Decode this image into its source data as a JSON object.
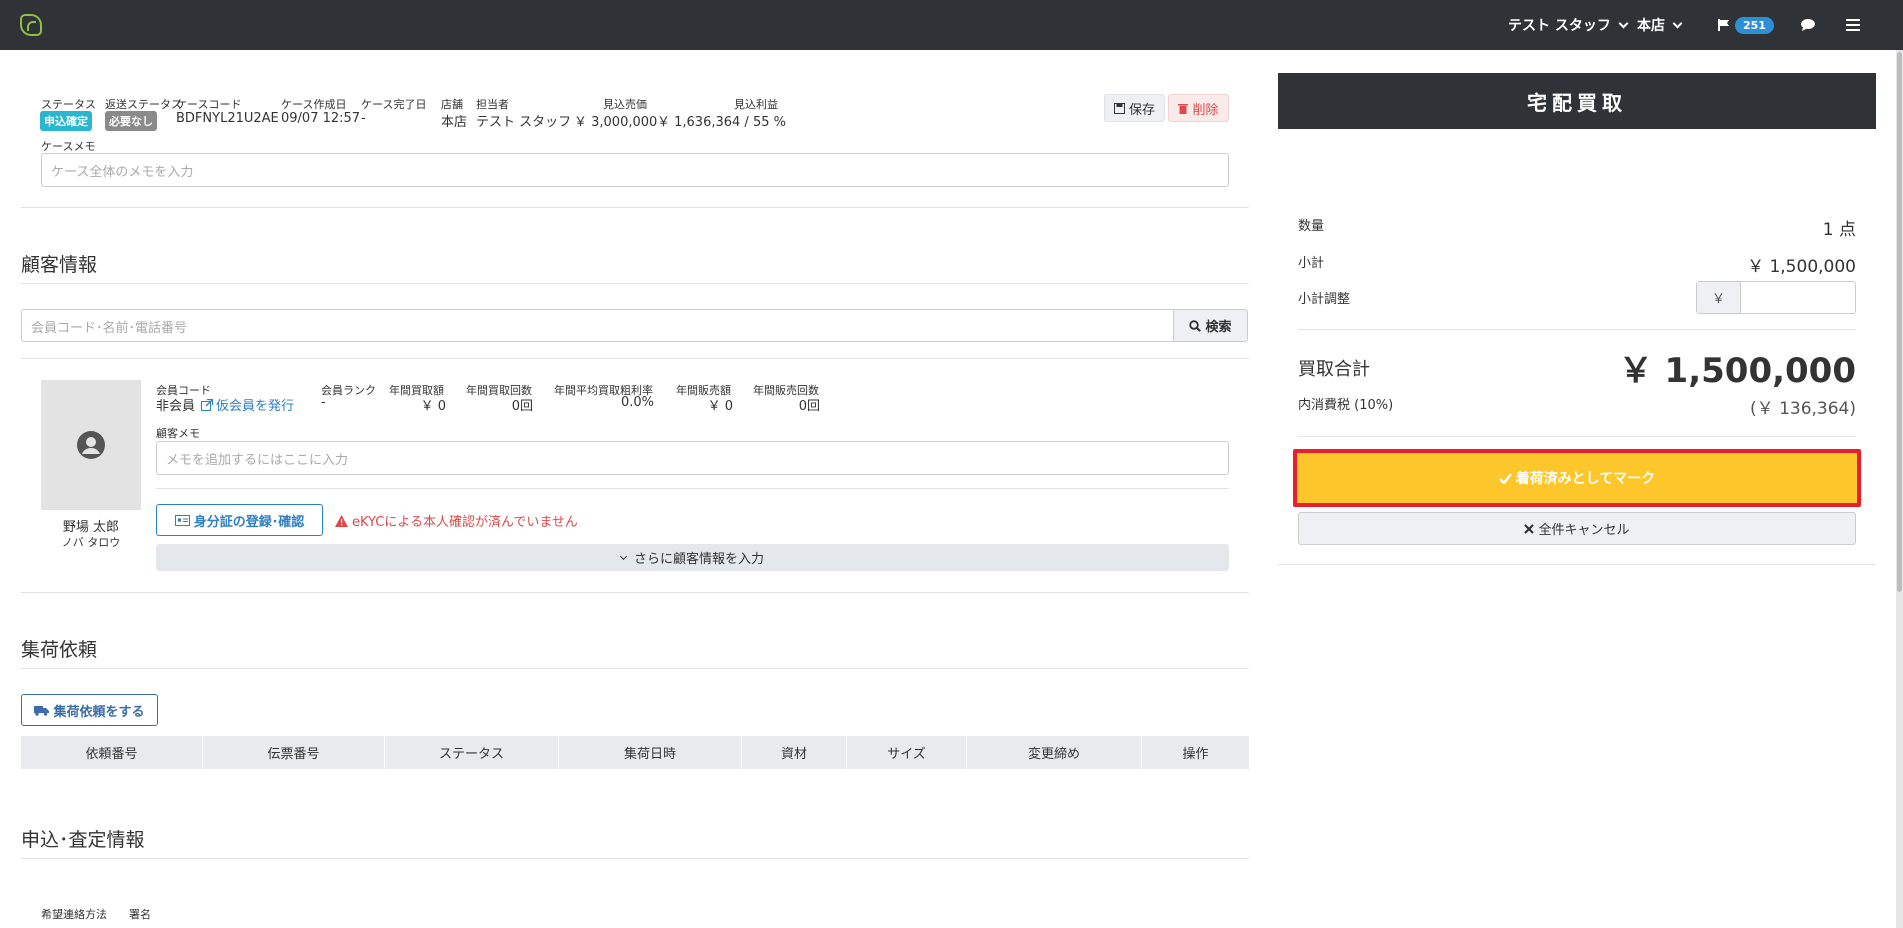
{
  "topbar": {
    "staff_label": "テスト スタッフ",
    "store_label": "本店",
    "notification_count": "251"
  },
  "case": {
    "labels": {
      "status": "ステータス",
      "return_status": "返送ステータス",
      "case_code": "ケースコード",
      "created": "ケース作成日",
      "completed": "ケース完了日",
      "store": "店舗",
      "assignee": "担当者",
      "expected_sales": "見込売価",
      "expected_profit": "見込利益",
      "memo": "ケースメモ"
    },
    "status_badge": "申込確定",
    "return_status_badge": "必要なし",
    "case_code": "BDFNYL21U2AE",
    "created": "09/07 12:57",
    "completed": "-",
    "store": "本店",
    "assignee": "テスト スタッフ",
    "expected_sales": "￥ 3,000,000",
    "expected_profit": "￥ 1,636,364 / 55 %",
    "memo_placeholder": "ケース全体のメモを入力",
    "save_label": "保存",
    "delete_label": "削除"
  },
  "customer": {
    "heading": "顧客情報",
    "search_placeholder": "会員コード･名前･電話番号",
    "search_label": "検索",
    "name": "野場 太郎",
    "kana": "ノバ タロウ",
    "labels": {
      "member_code": "会員コード",
      "member_rank": "会員ランク",
      "annual_purchase_amount": "年間買取額",
      "annual_purchase_count": "年間買取回数",
      "avg_margin": "年間平均買取粗利率",
      "annual_sales_amount": "年間販売額",
      "annual_sales_count": "年間販売回数",
      "memo": "顧客メモ"
    },
    "member_status": "非会員",
    "issue_temp_member": "仮会員を発行",
    "member_rank": "-",
    "annual_purchase_amount": "￥ 0",
    "annual_purchase_count": "0回",
    "avg_margin": "0.0%",
    "annual_sales_amount": "￥ 0",
    "annual_sales_count": "0回",
    "memo_placeholder": "メモを追加するにはここに入力",
    "id_button": "身分証の登録･確認",
    "kyc_warning": "eKYCによる本人確認が済んでいません",
    "more_info": "さらに顧客情報を入力"
  },
  "pickup": {
    "heading": "集荷依頼",
    "request_button": "集荷依頼をする",
    "columns": [
      "依頼番号",
      "伝票番号",
      "ステータス",
      "集荷日時",
      "資材",
      "サイズ",
      "変更締め",
      "操作"
    ]
  },
  "application": {
    "heading": "申込･査定情報",
    "labels": {
      "contact_method": "希望連絡方法",
      "signature": "署名"
    }
  },
  "panel": {
    "title": "宅配買取",
    "quantity_label": "数量",
    "quantity_value": "1 点",
    "subtotal_label": "小計",
    "subtotal_value": "￥ 1,500,000",
    "adjust_label": "小計調整",
    "adjust_prefix": "￥",
    "adjust_value": "",
    "total_label": "買取合計",
    "total_value": "￥ 1,500,000",
    "tax_label": "内消費税 (10%)",
    "tax_value": "(￥ 136,364)",
    "mark_arrived": "着荷済みとしてマーク",
    "cancel_all": "全件キャンセル"
  },
  "colors": {
    "topbar": "#2f3237",
    "status_badge": "#29b6d1",
    "return_badge": "#8a8a8a",
    "danger": "#e04848",
    "link": "#2d7fc4",
    "primary_action": "#fdc62b",
    "highlight_border": "#e8202e"
  }
}
